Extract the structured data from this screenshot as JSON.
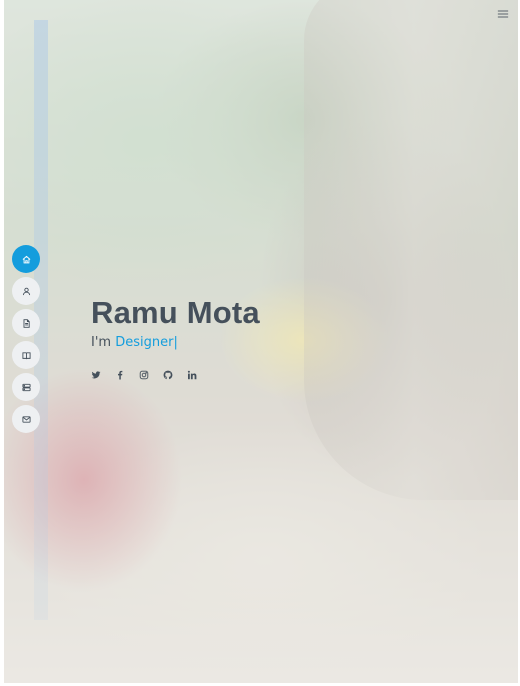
{
  "hero": {
    "name": "Ramu Mota",
    "prefix": "I'm ",
    "typed_word": "Designer",
    "cursor": "|"
  },
  "nav": {
    "items": [
      {
        "icon": "home-icon",
        "active": true
      },
      {
        "icon": "person-icon",
        "active": false
      },
      {
        "icon": "file-icon",
        "active": false
      },
      {
        "icon": "book-icon",
        "active": false
      },
      {
        "icon": "server-icon",
        "active": false
      },
      {
        "icon": "envelope-icon",
        "active": false
      }
    ]
  },
  "socials": [
    "twitter-icon",
    "facebook-icon",
    "instagram-icon",
    "github-icon",
    "linkedin-icon"
  ],
  "colors": {
    "accent": "#149ddd",
    "text": "#45505b",
    "nav_bg": "#eef0f2"
  }
}
